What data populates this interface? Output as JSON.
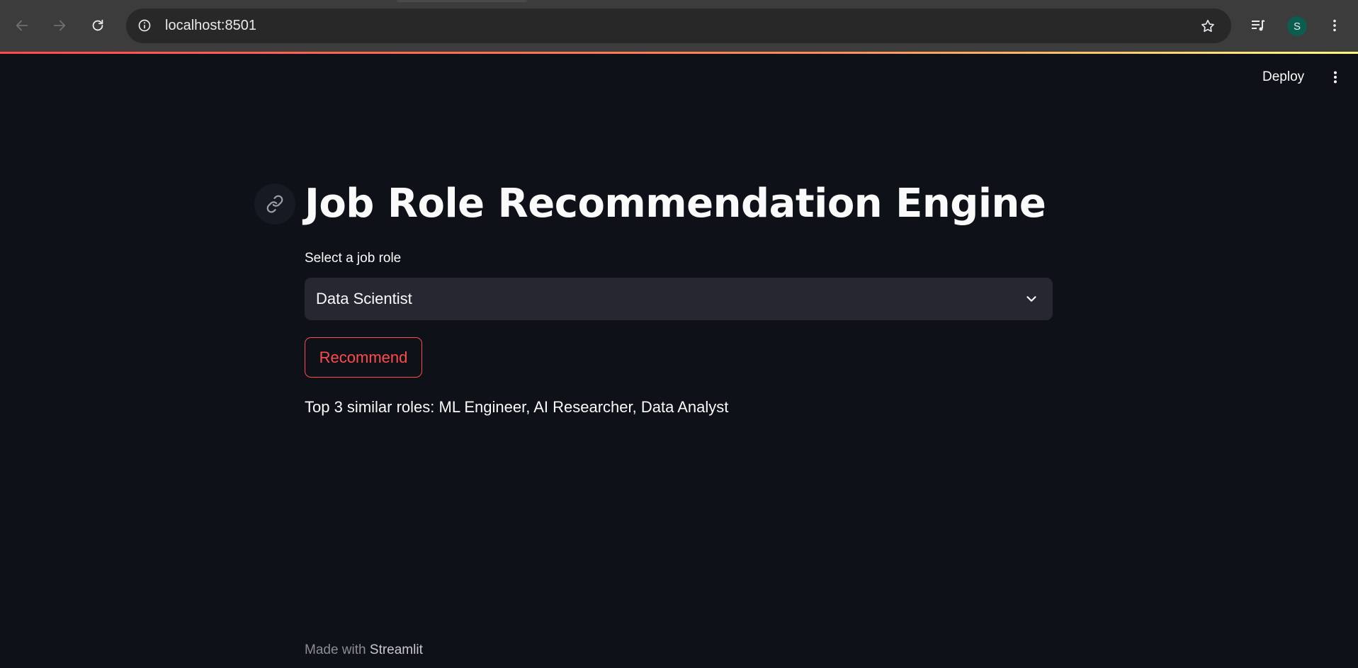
{
  "browser": {
    "url": "localhost:8501",
    "profile_initial": "S"
  },
  "header": {
    "deploy_label": "Deploy"
  },
  "main": {
    "title": "Job Role Recommendation Engine",
    "select_label": "Select a job role",
    "selected_role": "Data Scientist",
    "button_label": "Recommend",
    "result_text": "Top 3 similar roles: ML Engineer, AI Researcher, Data Analyst"
  },
  "footer": {
    "prefix": "Made with",
    "brand": "Streamlit"
  },
  "colors": {
    "background": "#0e1117",
    "primary": "#ff4b4b",
    "select_bg": "#262730",
    "chrome_bg": "#3c3c3c"
  },
  "icons": {
    "back": "arrow-left-icon",
    "forward": "arrow-right-icon",
    "reload": "reload-icon",
    "site_info": "info-icon",
    "bookmark": "star-icon",
    "media": "media-queue-icon",
    "menu": "kebab-menu-icon",
    "anchor": "link-icon",
    "chevron": "chevron-down-icon"
  }
}
